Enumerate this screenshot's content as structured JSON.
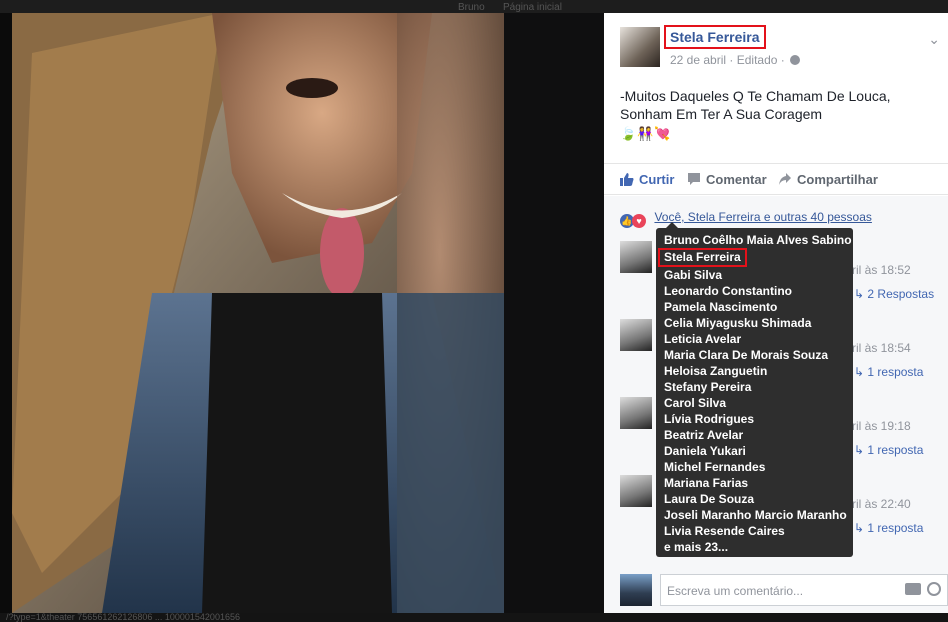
{
  "top_nav": {
    "items": [
      "Bruno",
      "Página inicial"
    ]
  },
  "bottom_status": "/?type=1&theater 756561262126806 ... 100001542001656",
  "post": {
    "author": "Stela Ferreira",
    "date": "22 de abril",
    "edited": "Editado",
    "text": "-Muitos Daqueles Q Te Chamam De Louca, Sonham Em Ter A Sua Coragem",
    "emojis": "🍃👭💘"
  },
  "actions": {
    "like": "Curtir",
    "comment": "Comentar",
    "share": "Compartilhar"
  },
  "reactions": {
    "summary": "Você, Stela Ferreira e outras 40 pessoas"
  },
  "comments": [
    {
      "time": "ril às 18:52",
      "replies": "2 Respostas"
    },
    {
      "time": "ril às 18:54",
      "replies": "1 resposta"
    },
    {
      "time": "ril às 19:18",
      "replies": "1 resposta"
    },
    {
      "time": "ril às 22:40",
      "replies": "1 resposta"
    }
  ],
  "write_comment": {
    "placeholder": "Escreva um comentário..."
  },
  "likers_tooltip": {
    "names": [
      "Bruno Coêlho Maia Alves Sabino",
      "Stela Ferreira",
      "Gabi Silva",
      "Leonardo Constantino",
      "Pamela Nascimento",
      "Celia Miyagusku Shimada",
      "Leticia Avelar",
      "Maria Clara De Morais Souza",
      "Heloisa Zanguetin",
      "Stefany Pereira",
      "Carol Silva",
      "Lívia Rodrigues",
      "Beatriz Avelar",
      "Daniela Yukari",
      "Michel Fernandes",
      "Mariana Farias",
      "Laura De Souza",
      "Joseli Maranho Marcio Maranho",
      "Livia Resende Caires",
      "e mais 23..."
    ]
  },
  "colors": {
    "highlight": "#e3111a",
    "link": "#365899",
    "like_blue": "#4267b2",
    "tooltip_bg": "#2e2e2e"
  }
}
